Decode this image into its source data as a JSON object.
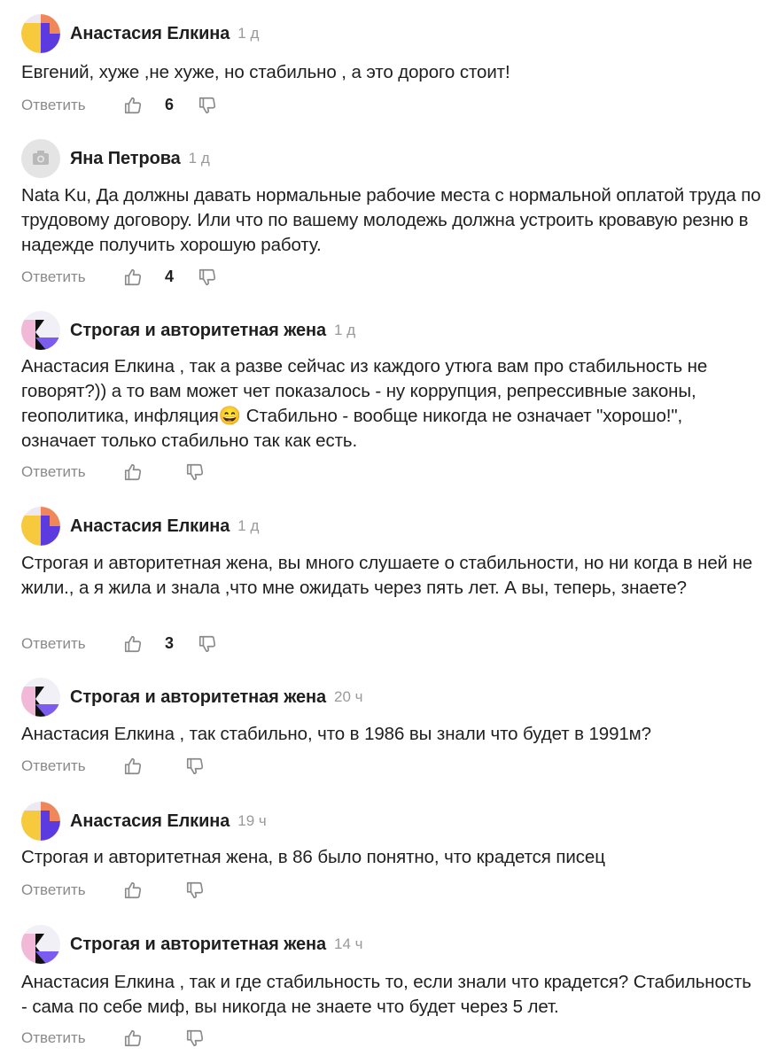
{
  "common": {
    "reply_label": "Ответить"
  },
  "comments": [
    {
      "author": "Анастасия Елкина",
      "time": "1 д",
      "avatar": "ae",
      "text": "Евгений, хуже ,не хуже, но стабильно , а это дорого стоит!",
      "likes": "6"
    },
    {
      "author": "Яна Петрова",
      "time": "1 д",
      "avatar": "camera",
      "text": "Nata Ku, Да должны давать нормальные рабочие места с нормальной оплатой труда по трудовому договору. Или что по вашему молодежь должна устроить кровавую резню в надежде получить хорошую работу.",
      "likes": "4"
    },
    {
      "author": "Строгая и авторитетная жена",
      "time": "1 д",
      "avatar": "sz",
      "text": "Анастасия Елкина , так а разве сейчас из каждого утюга вам про стабильность не говорят?)) а то вам может чет показалось - ну коррупция, репрессивные законы, геополитика, инфляция😄 Стабильно - вообще никогда не означает \"хорошо!\", означает только стабильно так как есть.",
      "likes": ""
    },
    {
      "author": "Анастасия Елкина",
      "time": "1 д",
      "avatar": "ae",
      "text": "Строгая и авторитетная жена, вы много слушаете о стабильности, но ни когда в ней не жили., а я жила и знала ,что мне ожидать через пять лет. А вы, теперь, знаете?",
      "likes": "3"
    },
    {
      "author": "Строгая и авторитетная жена",
      "time": "20 ч",
      "avatar": "sz",
      "text": "Анастасия Елкина , так стабильно, что в 1986 вы знали что будет в 1991м?",
      "likes": ""
    },
    {
      "author": "Анастасия Елкина",
      "time": "19 ч",
      "avatar": "ae",
      "text": "Строгая и авторитетная жена, в 86 было понятно, что крадется писец",
      "likes": ""
    },
    {
      "author": "Строгая и авторитетная жена",
      "time": "14 ч",
      "avatar": "sz",
      "text": "Анастасия Елкина , так и где стабильность то, если знали что крадется? Стабильность - сама по себе миф, вы никогда не знаете что будет через 5 лет.",
      "likes": ""
    }
  ],
  "colors": {
    "text": "#1f1f1f",
    "muted": "#8a8a8a",
    "time": "#9a9a9a",
    "ae_yellow": "#f7c93d",
    "ae_purple": "#5b3be0",
    "ae_orange": "#f0875a",
    "sz_pink": "#f2b8d8",
    "sz_purple": "#7c5cf0",
    "sz_black": "#111111"
  }
}
